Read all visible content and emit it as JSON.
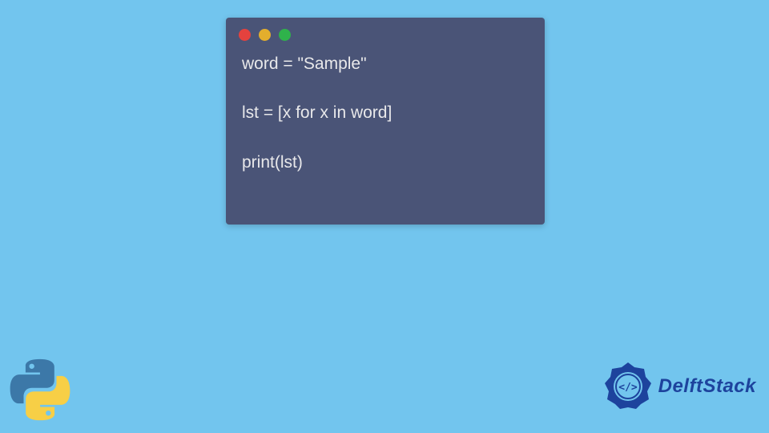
{
  "code": {
    "line1": "word = \"Sample\"",
    "line2": "lst = [x for x in word]",
    "line3": "print(lst)"
  },
  "branding": {
    "name": "DelftStack"
  },
  "colors": {
    "background": "#72c5ee",
    "window": "#4a5477",
    "dot_red": "#e4423e",
    "dot_yellow": "#e3ae2d",
    "dot_green": "#2fb24b",
    "brand_blue": "#1d439d",
    "python_blue": "#3c78a8",
    "python_yellow": "#f7cf46"
  }
}
